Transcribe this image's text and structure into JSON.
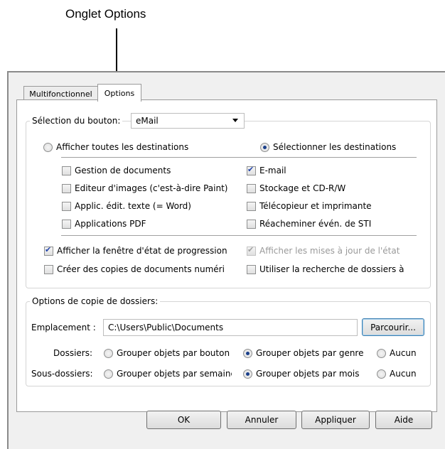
{
  "callout": "Onglet Options",
  "tabs": [
    {
      "label": "Multifonctionnel",
      "active": false
    },
    {
      "label": "Options",
      "active": true
    }
  ],
  "button_selection": {
    "label": "Sélection du bouton:",
    "value": "eMail"
  },
  "destinations": {
    "show_all": "Afficher toutes les destinations",
    "select": "Sélectionner les destinations",
    "selected": "select",
    "left_items": [
      {
        "label": "Gestion de documents",
        "checked": false
      },
      {
        "label": "Editeur d'images (c'est-à-dire Paint)",
        "checked": false
      },
      {
        "label": "Applic. édit. texte (= Word)",
        "checked": false
      },
      {
        "label": "Applications PDF",
        "checked": false
      }
    ],
    "right_items": [
      {
        "label": "E-mail",
        "checked": true
      },
      {
        "label": "Stockage et CD-R/W",
        "checked": false
      },
      {
        "label": "Télécopieur et imprimante",
        "checked": false
      },
      {
        "label": "Réacheminer évén. de STI",
        "checked": false
      }
    ]
  },
  "options": {
    "show_progress": {
      "label": "Afficher la fenêtre d'état de progression",
      "checked": true
    },
    "show_updates": {
      "label": "Afficher les mises à jour de l'état",
      "checked": true,
      "disabled": true
    },
    "create_copies": {
      "label": "Créer des copies de documents numéri",
      "checked": false
    },
    "folder_search": {
      "label": "Utiliser la recherche de dossiers à",
      "checked": false
    }
  },
  "folder_copy": {
    "legend": "Options de copie de dossiers:",
    "location_label": "Emplacement :",
    "location_value": "C:\\Users\\Public\\Documents",
    "browse": "Parcourir...",
    "folders_label": "Dossiers:",
    "folders_options": [
      "Grouper objets par bouton",
      "Grouper objets par genre",
      "Aucun"
    ],
    "folders_selected": 1,
    "subfolders_label": "Sous-dossiers:",
    "subfolders_options": [
      "Grouper objets par semaine",
      "Grouper objets par mois",
      "Aucun"
    ],
    "subfolders_selected": 1
  },
  "buttons": {
    "ok": "OK",
    "cancel": "Annuler",
    "apply": "Appliquer",
    "help": "Aide"
  }
}
